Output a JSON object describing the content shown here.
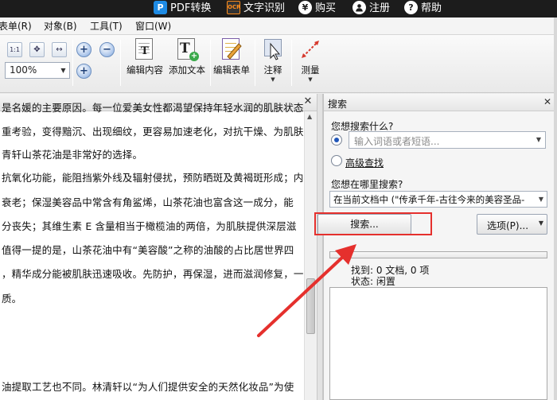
{
  "titlebar": {
    "items": [
      {
        "icon": "pdf-convert-icon",
        "glyph": "P",
        "label": "PDF转换"
      },
      {
        "icon": "ocr-icon",
        "glyph": "OCR",
        "label": "文字识别"
      },
      {
        "icon": "yen-icon",
        "glyph": "¥",
        "label": "购买"
      },
      {
        "icon": "user-icon",
        "glyph": "👤",
        "label": "注册"
      },
      {
        "icon": "help-icon",
        "glyph": "?",
        "label": "帮助"
      }
    ]
  },
  "menubar": {
    "items": [
      "表单(R)",
      "对象(B)",
      "工具(T)",
      "窗口(W)"
    ]
  },
  "toolbar": {
    "zoom_value": "100%",
    "buttons": {
      "edit_content": "编辑内容",
      "add_text": "添加文本",
      "edit_form": "编辑表单",
      "annotate": "注释",
      "measure": "测量"
    }
  },
  "document": {
    "lines": [
      "是名媛的主要原因。每一位爱美女性都渴望保持年轻水润的肌肤状态",
      "重考验，变得黯沉、出现细纹，更容易加速老化，对抗干燥、为肌肤",
      "青轩山茶花油是非常好的选择。",
      "抗氧化功能，能阻挡紫外线及辐射侵扰，预防晒斑及黄褐斑形成；内",
      "衰老；保湿美容品中常含有角鲨烯，山茶花油也富含这一成分，能",
      "分丧失；其维生素 E 含量相当于橄榄油的两倍，为肌肤提供深层滋",
      "值得一提的是，山茶花油中有“美容酸”之称的油酸的占比居世界四",
      "，精华成分能被肌肤迅速吸收。先防护，再保湿，进而滋润修复，一",
      "质。",
      "油提取工艺也不同。林清轩以“为人们提供安全的天然化妆品”为使"
    ]
  },
  "search_pane": {
    "title": "搜索",
    "what_label": "您想搜索什么?",
    "query_placeholder": "输入词语或者短语...",
    "advanced_label": "高级查找",
    "where_label": "您想在哪里搜索?",
    "where_value": "在当前文档中 (\"传承千年-古往今来的美容圣品-",
    "search_button": "搜索...",
    "options_button": "选项(P)...",
    "found_text": "找到: 0 文档, 0 项",
    "status_label": "状态:",
    "status_value": "闲置"
  },
  "colors": {
    "highlight_box": "#e5302d",
    "arrow": "#e5302d",
    "titlebar_bg": "#1c1c1c"
  }
}
